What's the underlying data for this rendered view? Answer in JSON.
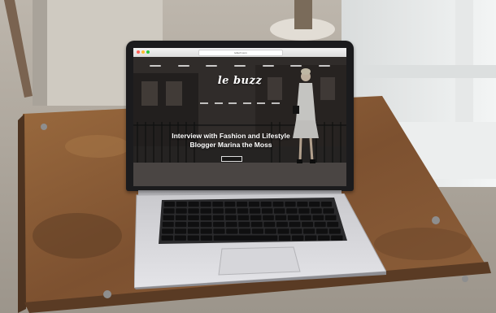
{
  "browser": {
    "url_text": "lebuzz.com",
    "traffic_colors": [
      "#ff5f57",
      "#febc2e",
      "#28c840"
    ]
  },
  "website": {
    "logo": "le buzz",
    "headline_line1": "Interview with Fashion and Lifestyle",
    "headline_line2": "Blogger Marina the Moss",
    "nav_items": [
      "nav-1",
      "nav-2",
      "nav-3",
      "nav-4",
      "nav-5",
      "nav-6",
      "nav-7"
    ],
    "subnav_items": [
      "sub-1",
      "sub-2",
      "sub-3",
      "sub-4",
      "sub-5",
      "sub-6"
    ]
  },
  "colors": {
    "table_wood": "#8a5a34",
    "laptop_silver": "#d8d8dc",
    "bezel": "#1b1b1d"
  }
}
